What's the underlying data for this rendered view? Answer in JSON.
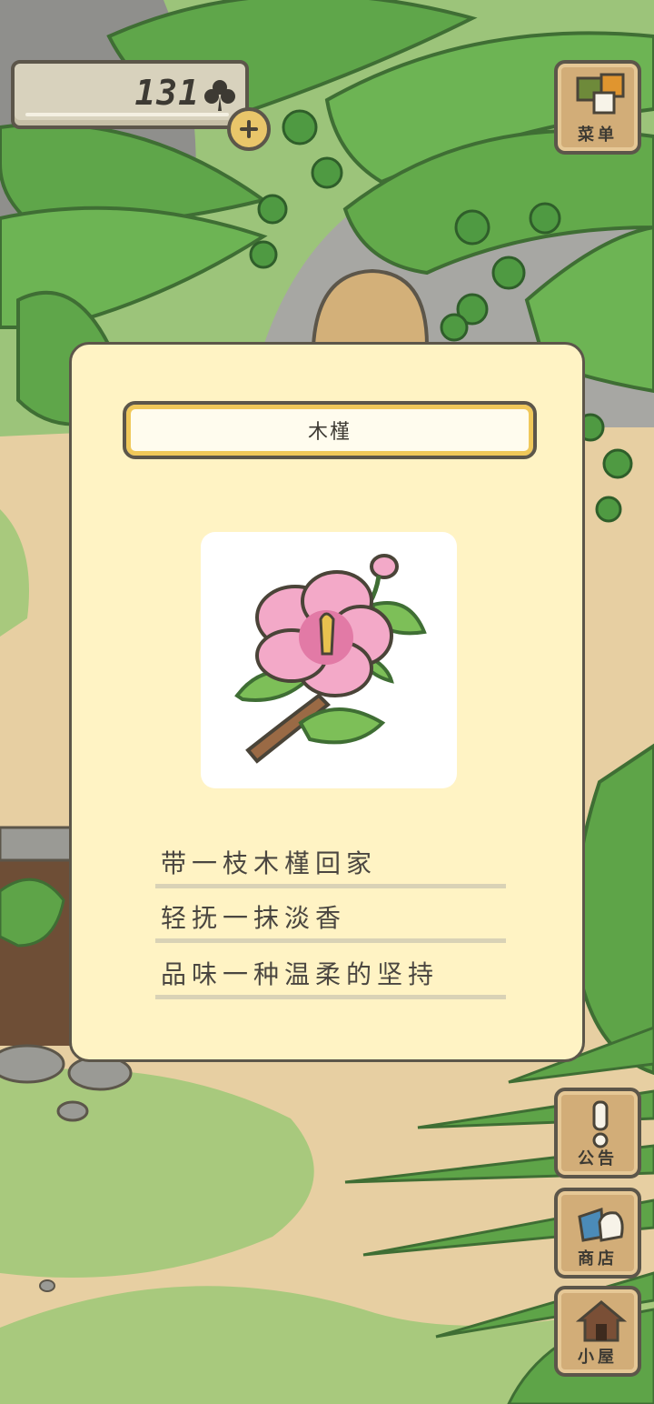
{
  "status": {
    "clover_count": "131"
  },
  "menu": {
    "label": "菜单"
  },
  "side_buttons": [
    {
      "label": "公告",
      "icon": "exclamation-icon"
    },
    {
      "label": "商店",
      "icon": "shop-bags-icon"
    },
    {
      "label": "小屋",
      "icon": "house-icon"
    }
  ],
  "card": {
    "title": "木槿",
    "description": [
      "带一枝木槿回家",
      "轻抚一抹淡香",
      "品味一种温柔的坚持"
    ],
    "image_icon": "hibiscus-flower-icon"
  },
  "colors": {
    "card_bg": "#fff3c4",
    "outline": "#5c564a",
    "title_accent": "#f0c85a",
    "wood": "#d2ad78"
  }
}
